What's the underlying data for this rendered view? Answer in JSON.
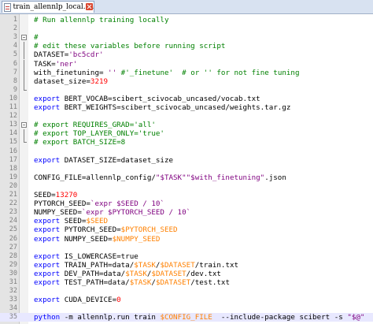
{
  "tab": {
    "filename": "train_allennlp_local.sh"
  },
  "lines": [
    [
      {
        "t": "# Run allennlp training locally",
        "c": "cmt"
      }
    ],
    [],
    [
      {
        "t": "#",
        "c": "cmt"
      }
    ],
    [
      {
        "t": "# edit these variables before running script",
        "c": "cmt"
      }
    ],
    [
      {
        "t": "DATASET=",
        "c": "o"
      },
      {
        "t": "'bc5cdr'",
        "c": "s"
      }
    ],
    [
      {
        "t": "TASK=",
        "c": "o"
      },
      {
        "t": "'ner'",
        "c": "s"
      }
    ],
    [
      {
        "t": "with_finetuning= ",
        "c": "o"
      },
      {
        "t": "''",
        "c": "s"
      },
      {
        "t": " #",
        "c": "cmt"
      },
      {
        "t": "'_finetune'",
        "c": "cmt"
      },
      {
        "t": "  # or '' for not fine tuning",
        "c": "cmt"
      }
    ],
    [
      {
        "t": "dataset_size=",
        "c": "o"
      },
      {
        "t": "3219",
        "c": "n"
      }
    ],
    [],
    [
      {
        "t": "export",
        "c": "k"
      },
      {
        "t": " BERT_VOCAB=scibert_scivocab_uncased/vocab.txt",
        "c": "o"
      }
    ],
    [
      {
        "t": "export",
        "c": "k"
      },
      {
        "t": " BERT_WEIGHTS=scibert_scivocab_uncased/weights.tar.gz",
        "c": "o"
      }
    ],
    [],
    [
      {
        "t": "# export REQUIRES_GRAD='all'",
        "c": "cmt"
      }
    ],
    [
      {
        "t": "# export TOP_LAYER_ONLY='true'",
        "c": "cmt"
      }
    ],
    [
      {
        "t": "# export BATCH_SIZE=8",
        "c": "cmt"
      }
    ],
    [],
    [
      {
        "t": "export",
        "c": "k"
      },
      {
        "t": " DATASET_SIZE=dataset_size",
        "c": "o"
      }
    ],
    [],
    [
      {
        "t": "CONFIG_FILE=allennlp_config/",
        "c": "o"
      },
      {
        "t": "\"$TASK\"",
        "c": "s"
      },
      {
        "t": "\"$with_finetuning\"",
        "c": "s"
      },
      {
        "t": ".json",
        "c": "o"
      }
    ],
    [],
    [
      {
        "t": "SEED=",
        "c": "o"
      },
      {
        "t": "13270",
        "c": "n"
      }
    ],
    [
      {
        "t": "PYTORCH_SEED=",
        "c": "o"
      },
      {
        "t": "`expr $SEED / 10`",
        "c": "s"
      }
    ],
    [
      {
        "t": "NUMPY_SEED=",
        "c": "o"
      },
      {
        "t": "`expr $PYTORCH_SEED / 10`",
        "c": "s"
      }
    ],
    [
      {
        "t": "export",
        "c": "k"
      },
      {
        "t": " SEED=",
        "c": "o"
      },
      {
        "t": "$SEED",
        "c": "v"
      }
    ],
    [
      {
        "t": "export",
        "c": "k"
      },
      {
        "t": " PYTORCH_SEED=",
        "c": "o"
      },
      {
        "t": "$PYTORCH_SEED",
        "c": "v"
      }
    ],
    [
      {
        "t": "export",
        "c": "k"
      },
      {
        "t": " NUMPY_SEED=",
        "c": "o"
      },
      {
        "t": "$NUMPY_SEED",
        "c": "v"
      }
    ],
    [],
    [
      {
        "t": "export",
        "c": "k"
      },
      {
        "t": " IS_LOWERCASE=true",
        "c": "o"
      }
    ],
    [
      {
        "t": "export",
        "c": "k"
      },
      {
        "t": " TRAIN_PATH=data/",
        "c": "o"
      },
      {
        "t": "$TASK",
        "c": "v"
      },
      {
        "t": "/",
        "c": "o"
      },
      {
        "t": "$DATASET",
        "c": "v"
      },
      {
        "t": "/train.txt",
        "c": "o"
      }
    ],
    [
      {
        "t": "export",
        "c": "k"
      },
      {
        "t": " DEV_PATH=data/",
        "c": "o"
      },
      {
        "t": "$TASK",
        "c": "v"
      },
      {
        "t": "/",
        "c": "o"
      },
      {
        "t": "$DATASET",
        "c": "v"
      },
      {
        "t": "/dev.txt",
        "c": "o"
      }
    ],
    [
      {
        "t": "export",
        "c": "k"
      },
      {
        "t": " TEST_PATH=data/",
        "c": "o"
      },
      {
        "t": "$TASK",
        "c": "v"
      },
      {
        "t": "/",
        "c": "o"
      },
      {
        "t": "$DATASET",
        "c": "v"
      },
      {
        "t": "/test.txt",
        "c": "o"
      }
    ],
    [],
    [
      {
        "t": "export",
        "c": "k"
      },
      {
        "t": " CUDA_DEVICE=",
        "c": "o"
      },
      {
        "t": "0",
        "c": "n"
      }
    ],
    [],
    [
      {
        "t": "python",
        "c": "k"
      },
      {
        "t": " -m allennlp.run train ",
        "c": "o"
      },
      {
        "t": "$CONFIG_FILE",
        "c": "v"
      },
      {
        "t": "  --include-package scibert -s ",
        "c": "o"
      },
      {
        "t": "\"$@\"",
        "c": "s"
      }
    ]
  ],
  "line_numbers": [
    "1",
    "2",
    "3",
    "4",
    "5",
    "6",
    "7",
    "8",
    "9",
    "10",
    "11",
    "12",
    "13",
    "14",
    "15",
    "16",
    "17",
    "18",
    "19",
    "20",
    "21",
    "22",
    "23",
    "24",
    "25",
    "26",
    "27",
    "28",
    "29",
    "30",
    "31",
    "32",
    "33",
    "34",
    "35"
  ],
  "current_line": 35,
  "syntax_colors": {
    "comment": "#008000",
    "keyword": "#0000ff",
    "string": "#7f007f",
    "number": "#ff0000",
    "variable": "#ff8000"
  },
  "icons": {
    "file": "file-icon",
    "close": "close-icon"
  }
}
